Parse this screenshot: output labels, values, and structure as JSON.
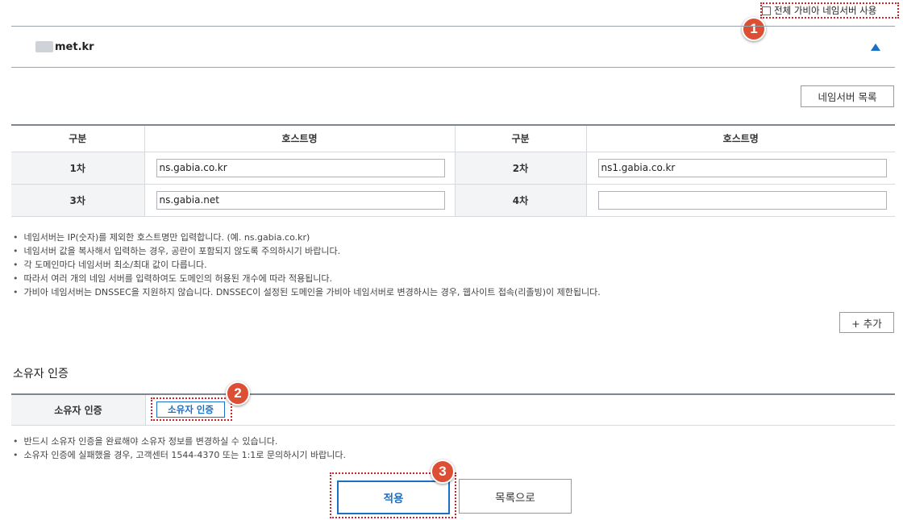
{
  "top_option": {
    "label": "전체 가비아 네임서버 사용",
    "checked": false
  },
  "callouts": [
    "1",
    "2",
    "3"
  ],
  "domain": {
    "name": "met.kr",
    "collapse_icon": "triangle-up-icon"
  },
  "nameserver_list_button": "네임서버 목록",
  "table": {
    "headers": [
      "구분",
      "호스트명",
      "구분",
      "호스트명"
    ],
    "rows": [
      {
        "label_a": "1차",
        "host_a": "ns.gabia.co.kr",
        "label_b": "2차",
        "host_b": "ns1.gabia.co.kr"
      },
      {
        "label_a": "3차",
        "host_a": "ns.gabia.net",
        "label_b": "4차",
        "host_b": ""
      }
    ]
  },
  "notes": [
    "네임서버는 IP(숫자)를 제외한 호스트명만 입력합니다. (예. ns.gabia.co.kr)",
    "네임서버 값을 복사해서 입력하는 경우, 공란이 포함되지 않도록 주의하시기 바랍니다.",
    "각 도메인마다 네임서버 최소/최대 값이 다릅니다.",
    "따라서 여러 개의 네임 서버를 입력하여도 도메인의 허용된 개수에 따라 적용됩니다.",
    "가비아 네임서버는 DNSSEC을 지원하지 않습니다. DNSSEC이 설정된 도메인을 가비아 네임서버로 변경하시는 경우, 웹사이트 접속(리졸빙)이 제한됩니다."
  ],
  "add_button": "+ 추가",
  "owner": {
    "section_title": "소유자 인증",
    "row_label": "소유자 인증",
    "button": "소유자 인증",
    "notes": [
      "반드시 소유자 인증을 완료해야 소유자 정보를 변경하실 수 있습니다.",
      "소유자 인증에 실패했을 경우, 고객센터 1544-4370 또는 1:1로 문의하시기 바랍니다."
    ]
  },
  "actions": {
    "apply": "적용",
    "list": "목록으로"
  },
  "colors": {
    "accent": "#1a6fc7",
    "callout": "#dd4f34",
    "highlight": "#c9252c"
  }
}
